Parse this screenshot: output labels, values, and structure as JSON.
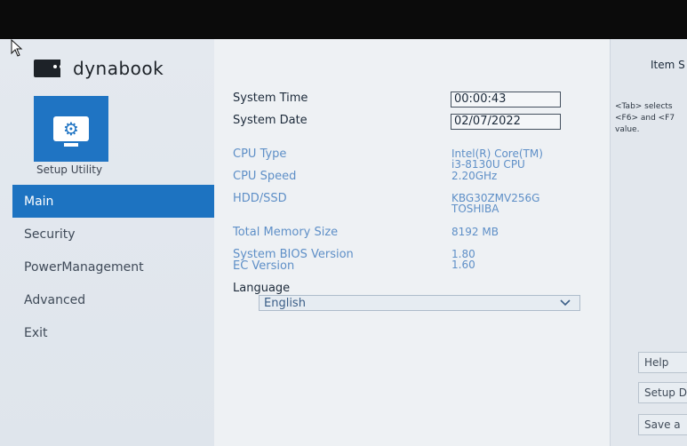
{
  "brand": {
    "name": "dynabook"
  },
  "setup": {
    "label": "Setup Utility"
  },
  "nav": {
    "items": [
      {
        "label": "Main"
      },
      {
        "label": "Security"
      },
      {
        "label": "PowerManagement"
      },
      {
        "label": "Advanced"
      },
      {
        "label": "Exit"
      }
    ],
    "active": "Main"
  },
  "main": {
    "system_time": {
      "label": "System Time",
      "value": "00:00:43"
    },
    "system_date": {
      "label": "System Date",
      "value": "02/07/2022"
    },
    "cpu_type": {
      "label": "CPU Type",
      "value_line1": "Intel(R) Core(TM)",
      "value_line2": "i3-8130U CPU"
    },
    "cpu_speed": {
      "label": "CPU Speed",
      "value": "2.20GHz"
    },
    "hdd": {
      "label": "HDD/SSD",
      "value_line1": "KBG30ZMV256G",
      "value_line2": "TOSHIBA"
    },
    "memory": {
      "label": "Total Memory Size",
      "value": "8192 MB"
    },
    "bios": {
      "label": "System BIOS Version",
      "value": "1.80"
    },
    "ec": {
      "label": "EC Version",
      "value": "1.60"
    },
    "language": {
      "label": "Language",
      "value": "English"
    }
  },
  "help": {
    "title": "Item S",
    "line1": "<Tab> selects",
    "line2": "<F6> and <F7",
    "line3": "value.",
    "buttons": [
      "Help",
      "Setup D",
      "Save a"
    ]
  },
  "colors": {
    "active_nav": "#1d73c1",
    "info_text": "#5e8fc7",
    "icon_bg": "#1f74c3"
  }
}
